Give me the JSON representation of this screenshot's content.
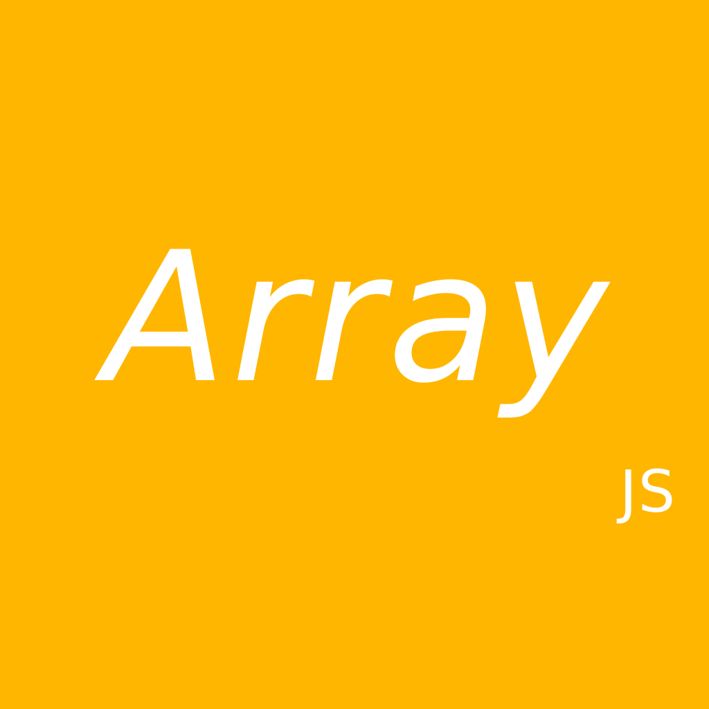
{
  "colors": {
    "background": "#FFB600",
    "text": "#FFFFFF"
  },
  "title": "Array",
  "badge": "JS"
}
